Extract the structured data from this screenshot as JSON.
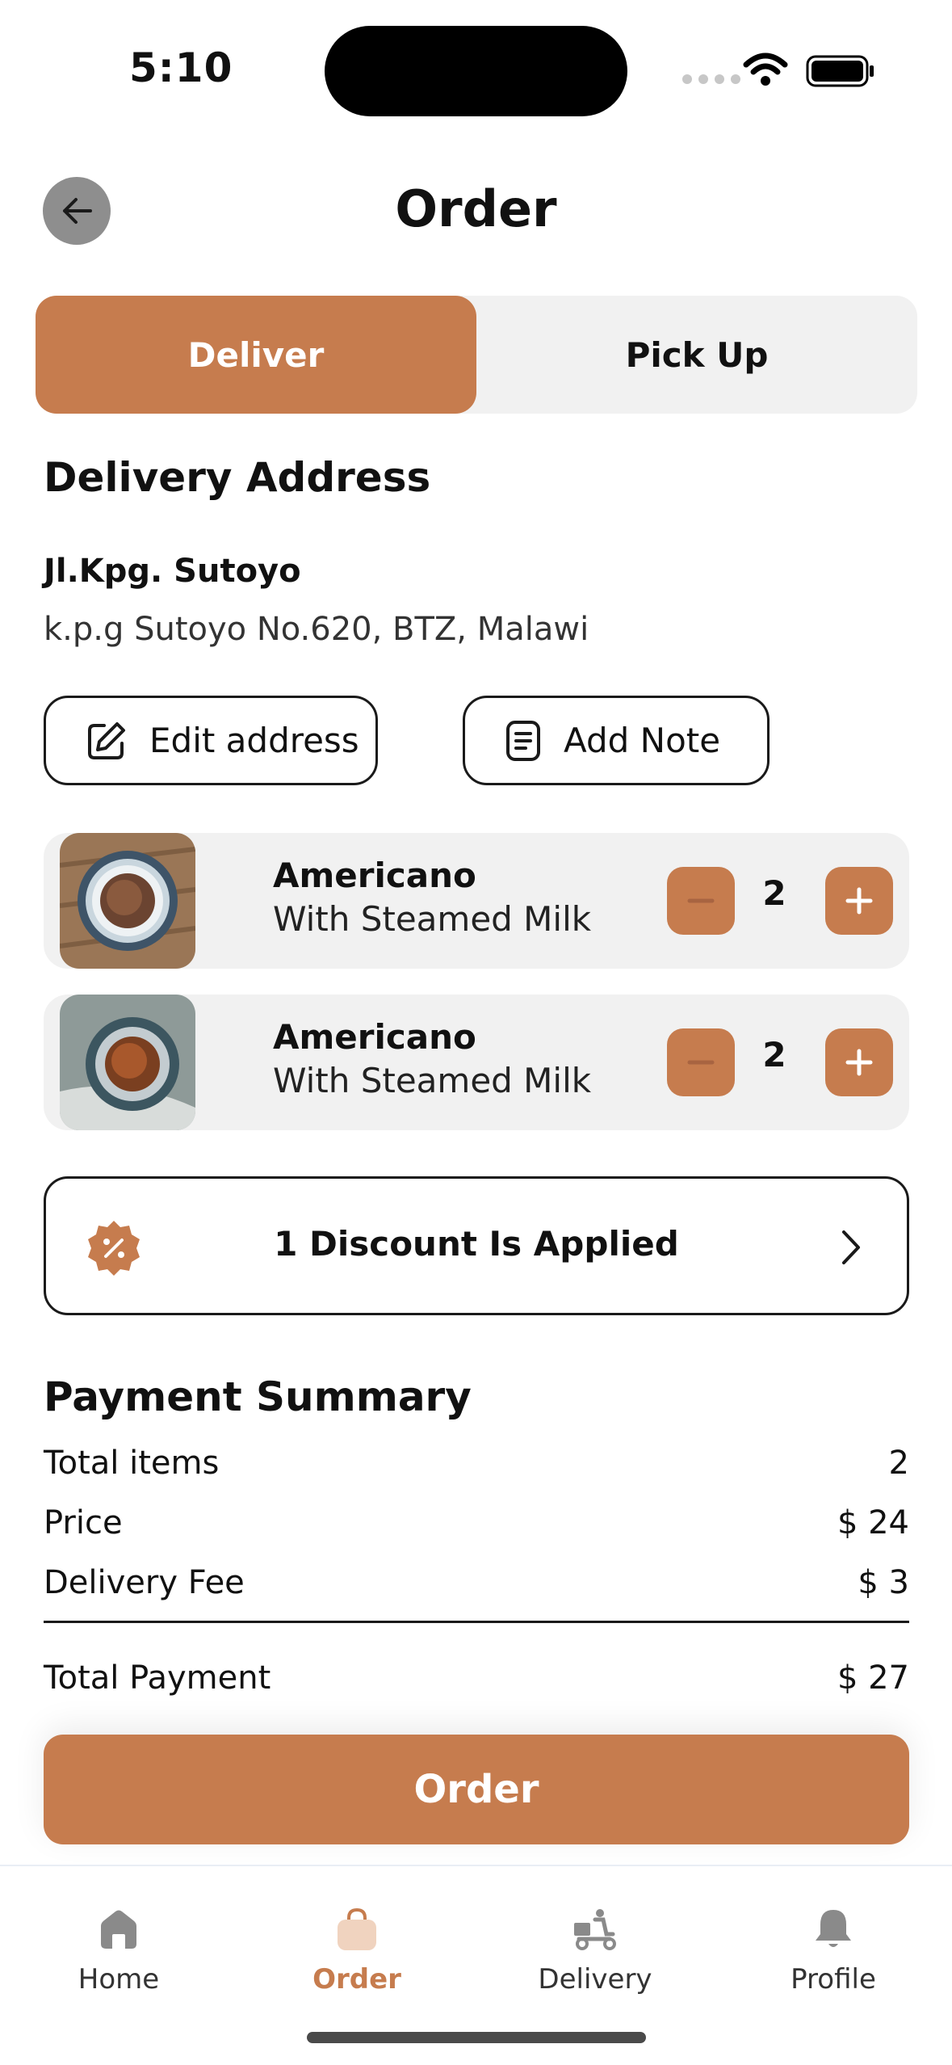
{
  "status_bar": {
    "time": "5:10"
  },
  "header": {
    "title": "Order"
  },
  "tabs": [
    {
      "label": "Deliver",
      "active": true
    },
    {
      "label": "Pick Up",
      "active": false
    }
  ],
  "delivery": {
    "section_title": "Delivery Address",
    "address_name": "Jl.Kpg. Sutoyo",
    "address_detail": "k.p.g Sutoyo No.620, BTZ, Malawi",
    "edit_label": "Edit address",
    "note_label": "Add Note"
  },
  "items": [
    {
      "name": "Americano",
      "description": "With Steamed Milk",
      "quantity": "2",
      "thumb_icon": "coffee-cup-photo"
    },
    {
      "name": "Americano",
      "description": "With Steamed Milk",
      "quantity": "2",
      "thumb_icon": "coffee-cup-photo"
    }
  ],
  "discount": {
    "label": "1 Discount Is Applied",
    "icon": "discount-badge-icon"
  },
  "payment": {
    "title": "Payment Summary",
    "rows": [
      {
        "label": "Total items",
        "value": "2"
      },
      {
        "label": "Price",
        "value": "$ 24"
      },
      {
        "label": "Delivery Fee",
        "value": "$ 3"
      }
    ],
    "total_label": "Total Payment",
    "total_value": "$ 27"
  },
  "order_button": "Order",
  "nav": [
    {
      "label": "Home",
      "icon": "home-icon",
      "active": false
    },
    {
      "label": "Order",
      "icon": "bag-icon",
      "active": true
    },
    {
      "label": "Delivery",
      "icon": "delivery-scooter-icon",
      "active": false
    },
    {
      "label": "Profile",
      "icon": "bell-icon",
      "active": false
    }
  ],
  "colors": {
    "accent": "#c67c4e",
    "segment_bg": "#f1f1f1",
    "text": "#111111"
  }
}
